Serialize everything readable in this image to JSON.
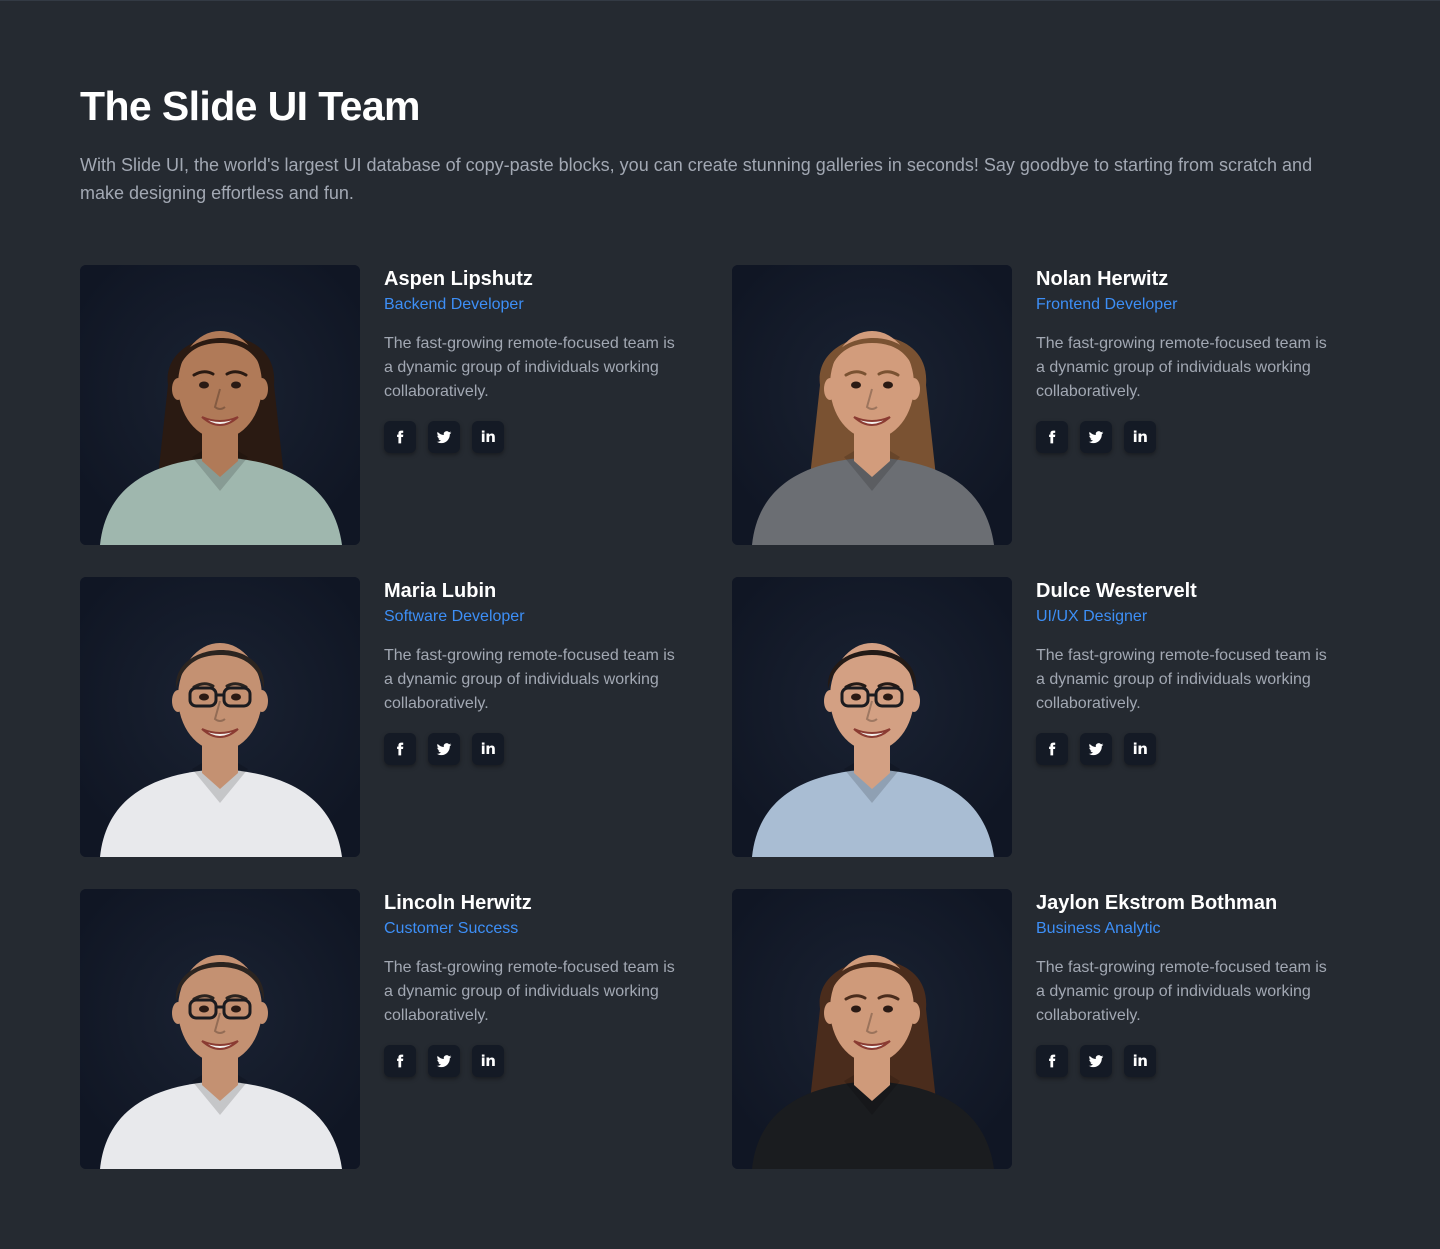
{
  "header": {
    "title": "The Slide UI Team",
    "subtitle": "With Slide UI, the world's largest UI database of copy-paste blocks, you can create stunning galleries in seconds! Say goodbye to starting from scratch and make designing effortless and fun."
  },
  "colors": {
    "background": "#252a31",
    "card_photo_bg": "#111827",
    "accent": "#3d8ff7",
    "text_muted": "#a2a8b3",
    "social_bg": "#141a25"
  },
  "team": [
    {
      "name": "Aspen Lipshutz",
      "role": "Backend Developer",
      "bio": "The fast-growing remote-focused team is a dynamic group of individuals working collaboratively.",
      "photo": {
        "hair": "#2a1a12",
        "skin": "#b07a58",
        "shirt": "#9fb7ae",
        "long_hair": true,
        "glasses": false
      },
      "socials": [
        "facebook-icon",
        "twitter-icon",
        "linkedin-icon"
      ]
    },
    {
      "name": "Nolan Herwitz",
      "role": "Frontend Developer",
      "bio": "The fast-growing remote-focused team is a dynamic group of individuals working collaboratively.",
      "photo": {
        "hair": "#7a5232",
        "skin": "#d29c7c",
        "shirt": "#6b6e73",
        "long_hair": true,
        "glasses": false
      },
      "socials": [
        "facebook-icon",
        "twitter-icon",
        "linkedin-icon"
      ]
    },
    {
      "name": "Maria Lubin",
      "role": "Software Developer",
      "bio": "The fast-growing remote-focused team is a dynamic group of individuals working collaboratively.",
      "photo": {
        "hair": "#2b2420",
        "skin": "#c49172",
        "shirt": "#e8e9ec",
        "long_hair": false,
        "glasses": true
      },
      "socials": [
        "facebook-icon",
        "twitter-icon",
        "linkedin-icon"
      ]
    },
    {
      "name": "Dulce Westervelt",
      "role": "UI/UX Designer",
      "bio": "The fast-growing remote-focused team is a dynamic group of individuals working collaboratively.",
      "photo": {
        "hair": "#231a16",
        "skin": "#d3a083",
        "shirt": "#a9bdd3",
        "long_hair": false,
        "glasses": true
      },
      "socials": [
        "facebook-icon",
        "twitter-icon",
        "linkedin-icon"
      ]
    },
    {
      "name": "Lincoln Herwitz",
      "role": "Customer Success",
      "bio": "The fast-growing remote-focused team is a dynamic group of individuals working collaboratively.",
      "photo": {
        "hair": "#2b2420",
        "skin": "#c49172",
        "shirt": "#e8e9ec",
        "long_hair": false,
        "glasses": true
      },
      "socials": [
        "facebook-icon",
        "twitter-icon",
        "linkedin-icon"
      ]
    },
    {
      "name": "Jaylon Ekstrom Bothman",
      "role": "Business Analytic",
      "bio": "The fast-growing remote-focused team is a dynamic group of individuals working collaboratively.",
      "photo": {
        "hair": "#4a2c1c",
        "skin": "#cf9a7a",
        "shirt": "#1a1c1f",
        "long_hair": true,
        "glasses": false
      },
      "socials": [
        "facebook-icon",
        "twitter-icon",
        "linkedin-icon"
      ]
    }
  ]
}
